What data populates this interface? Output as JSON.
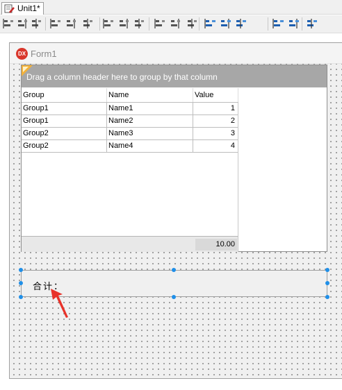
{
  "tab": {
    "title": "Unit1*"
  },
  "toolbar": {
    "buttons": [
      "align-left-icon",
      "align-right-icon",
      "align-hcenter-icon",
      "align-top-icon",
      "align-bottom-icon",
      "align-vcenter-icon",
      "space-equal-h-icon",
      "space-equal-v-icon",
      "center-in-window-h-icon",
      "center-in-window-v-icon",
      "size-to-grid-icon",
      "make-same-width-icon",
      "make-same-height-icon",
      "make-same-size-icon",
      "bring-to-front-icon",
      "send-to-back-icon",
      "tab-order-icon",
      "creation-order-icon"
    ]
  },
  "form": {
    "logo": "DX",
    "caption": "Form1"
  },
  "grid": {
    "group_panel_text": "Drag a column header here to group by that column",
    "columns": [
      "Group",
      "Name",
      "Value"
    ],
    "rows": [
      [
        "Group1",
        "Name1",
        "1"
      ],
      [
        "Group1",
        "Name2",
        "2"
      ],
      [
        "Group2",
        "Name3",
        "3"
      ],
      [
        "Group2",
        "Name4",
        "4"
      ]
    ],
    "footer_sum": "10.00"
  },
  "panel": {
    "label": "合计："
  },
  "colors": {
    "accent_handle": "#1f8fe8",
    "arrow": "#e8322a",
    "group_panel": "#a7a7a7",
    "logo": "#d9362b"
  }
}
